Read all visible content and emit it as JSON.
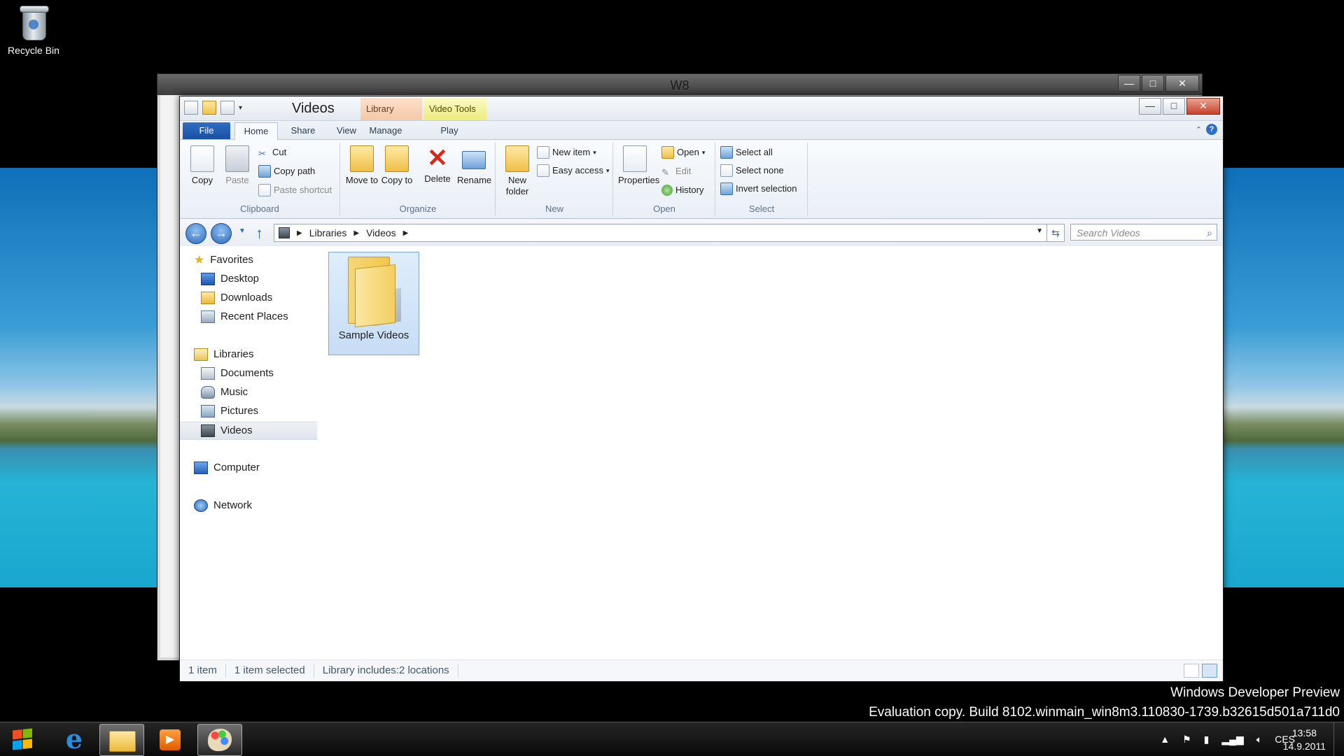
{
  "desktop": {
    "icons": [
      {
        "label": "Recycle Bin",
        "icon": "recycle-bin-icon"
      }
    ],
    "watermark": {
      "line1": "Windows Developer Preview",
      "line2": "Evaluation copy. Build 8102.winmain_win8m3.110830-1739.b32615d501a711d0"
    }
  },
  "back_window": {
    "title": "W8"
  },
  "window": {
    "title": "Videos",
    "context_tabs": {
      "library_tools": "Library Tools",
      "video_tools": "Video Tools"
    },
    "controls": {
      "minimize": "—",
      "maximize": "□",
      "close": "✕"
    },
    "ribbon_tabs": {
      "file": "File",
      "home": "Home",
      "share": "Share",
      "view": "View",
      "manage": "Manage",
      "play": "Play"
    },
    "ribbon": {
      "clipboard": {
        "label": "Clipboard",
        "copy": "Copy",
        "paste": "Paste",
        "cut": "Cut",
        "copy_path": "Copy path",
        "paste_shortcut": "Paste shortcut"
      },
      "organize": {
        "label": "Organize",
        "move_to": "Move to",
        "copy_to": "Copy to",
        "delete": "Delete",
        "rename": "Rename"
      },
      "new": {
        "label": "New",
        "new_folder": "New folder",
        "new_item": "New item",
        "easy_access": "Easy access"
      },
      "open": {
        "label": "Open",
        "properties": "Properties",
        "open": "Open",
        "edit": "Edit",
        "history": "History"
      },
      "select": {
        "label": "Select",
        "select_all": "Select all",
        "select_none": "Select none",
        "invert_selection": "Invert selection"
      }
    },
    "address": {
      "breadcrumb": [
        "Libraries",
        "Videos"
      ],
      "search_placeholder": "Search Videos"
    },
    "nav_pane": {
      "favorites": {
        "label": "Favorites",
        "items": [
          "Desktop",
          "Downloads",
          "Recent Places"
        ]
      },
      "libraries": {
        "label": "Libraries",
        "items": [
          "Documents",
          "Music",
          "Pictures",
          "Videos"
        ],
        "selected": "Videos"
      },
      "computer": "Computer",
      "network": "Network"
    },
    "files": [
      {
        "name": "Sample Videos",
        "type": "folder",
        "selected": true
      }
    ],
    "status": {
      "count": "1 item",
      "selected": "1 item selected",
      "library": "Library includes:2 locations"
    }
  },
  "taskbar": {
    "apps": [
      {
        "name": "internet-explorer",
        "active": false
      },
      {
        "name": "file-explorer",
        "active": true
      },
      {
        "name": "media-player",
        "active": false
      },
      {
        "name": "paint",
        "active": true
      }
    ],
    "tray": {
      "language": "CES",
      "time": "13:58",
      "date": "14.9.2011"
    }
  }
}
